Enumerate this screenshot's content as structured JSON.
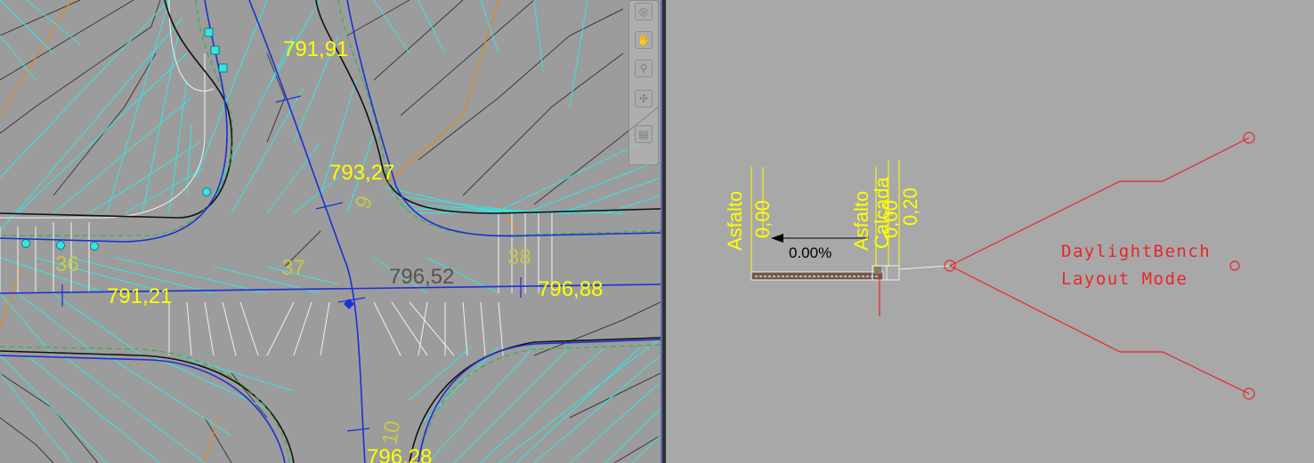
{
  "plan_view": {
    "elevation_labels": [
      "791,91",
      "793,27",
      "796,52",
      "796,88",
      "791,21",
      "796,28"
    ],
    "station_labels": [
      "36",
      "37",
      "38",
      "9",
      "10"
    ],
    "nav_tools": [
      "steering-wheel-icon",
      "pan-icon",
      "zoom-icon",
      "orbit-icon",
      "showmotion-icon"
    ]
  },
  "section_view": {
    "left_label": "Asfalto",
    "left_value": "0,00",
    "mid_label_1": "Asfalto",
    "mid_label_2": "Calçada",
    "mid_value_1": "0,00",
    "mid_value_2": "0,20",
    "slope": "0.00%",
    "mode_line1": "DaylightBench",
    "mode_line2": "Layout Mode"
  },
  "colors": {
    "plan_background": "#9c9c9c",
    "section_background": "#a8a8a8",
    "triangulation": "#33e6e6",
    "alignment": "#1a2fd6",
    "labels": "#ffff00",
    "subassembly_marker": "#e8262a"
  }
}
